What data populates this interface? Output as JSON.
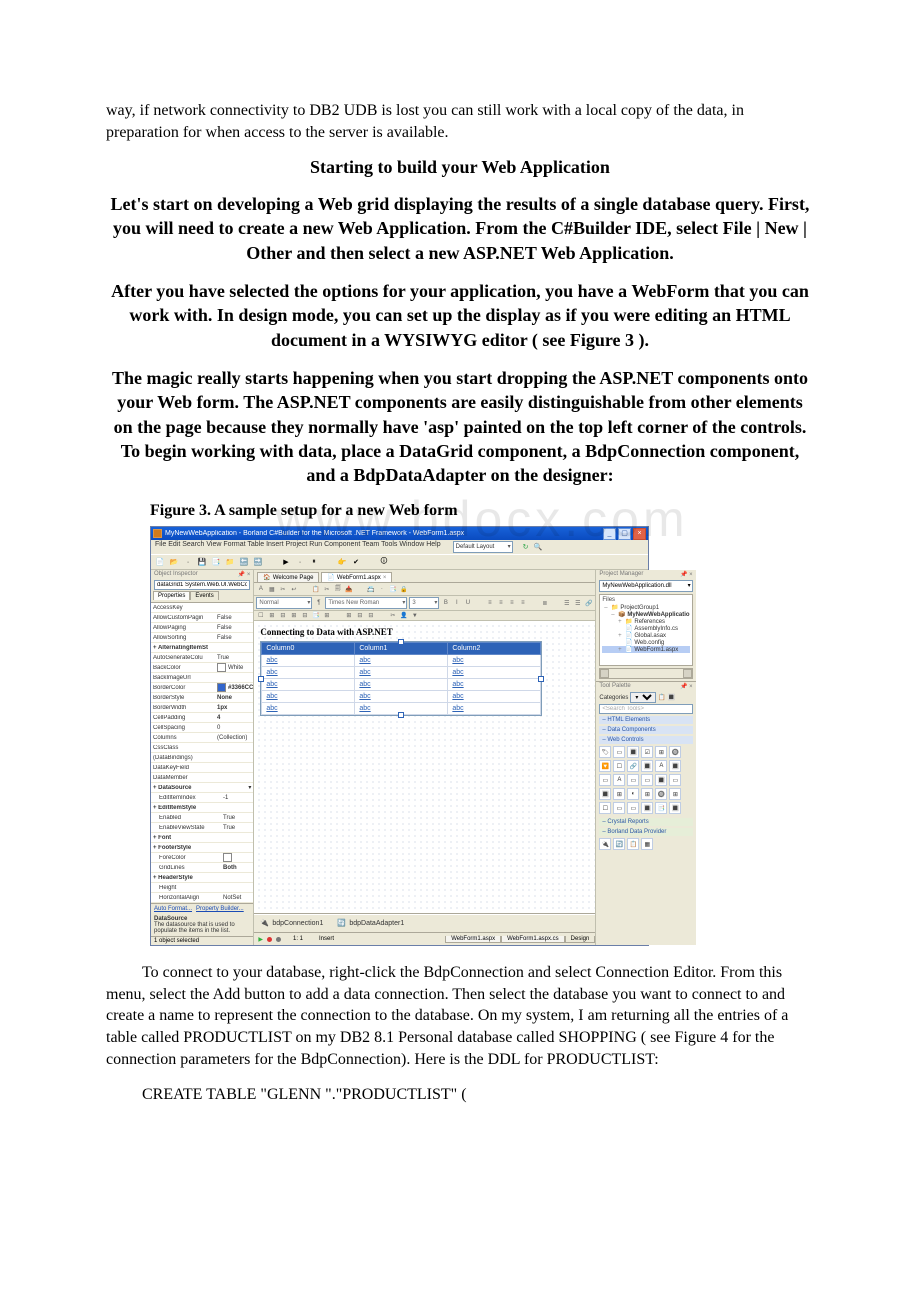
{
  "para_intro": "way, if network connectivity to DB2 UDB is lost you can still work with a local copy of the data, in preparation for when access to the server is available.",
  "heading_start": "Starting to build your Web Application",
  "bold1": "Let's start on developing a Web grid displaying the results of a single database query. First, you will need to create a new Web Application. From the C#Builder IDE, select File | New | Other and then select a new ASP.NET Web Application.",
  "bold2": "After you have selected the options for your application, you have a WebForm that you can work with. In design mode, you can set up the display as if you were editing an HTML document in a WYSIWYG editor ( see Figure 3 ).",
  "bold3": "The magic really starts happening when you start dropping the ASP.NET components onto your Web form. The ASP.NET components are easily distinguishable from other elements on the page because they normally have 'asp' painted on the top left corner of the controls. To begin working with data, place a DataGrid component, a BdpConnection component, and a BdpDataAdapter on the designer:",
  "figure_caption": "Figure 3. A sample setup for a new Web form",
  "watermark": "www.bdocx.com",
  "para_after1": "To connect to your database, right-click the BdpConnection and select Connection Editor. From this menu, select the Add button to add a data connection. Then select the database you want to connect to and create a name to represent the connection to the database. On my system, I am returning all the entries of a table called PRODUCTLIST on my DB2 8.1 Personal database called SHOPPING ( see Figure 4 for the connection parameters for the BdpConnection). Here is the DDL for PRODUCTLIST:",
  "code_line": "CREATE TABLE \"GLENN \".\"PRODUCTLIST\" (",
  "ide": {
    "title": "MyNewWebApplication - Borland C#Builder for the Microsoft .NET Framework - WebForm1.aspx",
    "menu": [
      "File",
      "Edit",
      "Search",
      "View",
      "Format",
      "Table",
      "Insert",
      "Project",
      "Run",
      "Component",
      "Team",
      "Tools",
      "Window",
      "Help"
    ],
    "layout_combo": "Default Layout",
    "toolbar_icons": [
      "📄",
      "📂",
      "·",
      "💾",
      "📑",
      "📁",
      "🔙",
      "🔜",
      " ",
      "▶",
      "·",
      "⏸",
      " ",
      "👉",
      "✔",
      " ",
      "🛈"
    ],
    "left": {
      "header": "Object Inspector",
      "close": "×",
      "combo": "dataGrid1 System.Web.UI.WebCon",
      "tabs": [
        "Properties",
        "Events"
      ],
      "props": [
        {
          "n": "AccessKey",
          "v": ""
        },
        {
          "n": "AllowCustomPagin",
          "v": "False"
        },
        {
          "n": "AllowPaging",
          "v": "False"
        },
        {
          "n": "AllowSorting",
          "v": "False"
        },
        {
          "n": "AlternatingItemSt",
          "v": "",
          "section": true,
          "exp": "+"
        },
        {
          "n": "AutoGenerateColu",
          "v": "True"
        },
        {
          "n": "BackColor",
          "v": "White",
          "swatch": "#ffffff"
        },
        {
          "n": "BackImageUrl",
          "v": ""
        },
        {
          "n": "BorderColor",
          "v": "#3366CC",
          "swatch": "#3366CC",
          "bold": true
        },
        {
          "n": "BorderStyle",
          "v": "None",
          "bold": true
        },
        {
          "n": "BorderWidth",
          "v": "1px",
          "bold": true
        },
        {
          "n": "CellPadding",
          "v": "4",
          "bold": true
        },
        {
          "n": "CellSpacing",
          "v": "0"
        },
        {
          "n": "Columns",
          "v": "(Collection)"
        },
        {
          "n": "CssClass",
          "v": ""
        },
        {
          "n": "(DataBindings)",
          "v": ""
        },
        {
          "n": "DataKeyField",
          "v": ""
        },
        {
          "n": "DataMember",
          "v": ""
        },
        {
          "n": "DataSource",
          "v": "",
          "section": true,
          "exp": "+",
          "dd": true
        },
        {
          "n": "EditItemIndex",
          "v": "-1",
          "indent": true
        },
        {
          "n": "EditItemStyle",
          "v": "",
          "section": true,
          "exp": "+"
        },
        {
          "n": "Enabled",
          "v": "True",
          "indent": true
        },
        {
          "n": "EnableViewState",
          "v": "True",
          "indent": true
        },
        {
          "n": "Font",
          "v": "",
          "section": true,
          "exp": "+"
        },
        {
          "n": "FooterStyle",
          "v": "",
          "section": true,
          "exp": "+"
        },
        {
          "n": "ForeColor",
          "v": "",
          "swatch": "#ffffff",
          "indent": true
        },
        {
          "n": "GridLines",
          "v": "Both",
          "bold": true,
          "indent": true
        },
        {
          "n": "HeaderStyle",
          "v": "",
          "section": true,
          "exp": "+"
        },
        {
          "n": "Height",
          "v": "",
          "indent": true
        },
        {
          "n": "HorizontalAlign",
          "v": "NotSet",
          "indent": true
        }
      ],
      "links": [
        "Auto Format...",
        "Property Builder..."
      ],
      "desc_title": "DataSource",
      "desc_body": "The datasource that is used to populate the items in the list.",
      "status": "1 object selected"
    },
    "center": {
      "tabs": [
        {
          "label": "Welcome Page",
          "icon": "🏠",
          "active": false
        },
        {
          "label": "WebForm1.aspx",
          "icon": "📄",
          "active": true,
          "close": true
        }
      ],
      "fmt_icons_a": [
        "A",
        "▦",
        "✂",
        "↩",
        " ",
        "📋",
        "✂",
        "🗐",
        "📥",
        " ",
        "📇",
        "·",
        "📑",
        "🔒"
      ],
      "style_dd": "Normal",
      "paragraph_icon": "¶",
      "font_dd": "Times New Roman",
      "size_dd": "3",
      "fmt_icons_b": [
        "B",
        "I",
        "U",
        " ",
        "≡",
        "≡",
        "≡",
        "≡",
        " ",
        "≣",
        " ",
        "☰",
        "☰",
        "🔗"
      ],
      "ruler_icons": [
        "☐",
        "⊞",
        "⊟",
        "⊞",
        "⊟",
        "📑",
        "⊞",
        " ",
        "⊞",
        "⊟",
        "⊟",
        " ",
        "✂",
        "👤",
        "▼"
      ],
      "doc_heading": "Connecting to Data with ASP.NET",
      "grid": {
        "cols": [
          "Column0",
          "Column1",
          "Column2"
        ],
        "cells": [
          [
            "abc",
            "abc",
            "abc"
          ],
          [
            "abc",
            "abc",
            "abc"
          ],
          [
            "abc",
            "abc",
            "abc"
          ],
          [
            "abc",
            "abc",
            "abc"
          ],
          [
            "abc",
            "abc",
            "abc"
          ]
        ]
      },
      "components": [
        {
          "icon": "🔌",
          "label": "bdpConnection1",
          "color": "#d24aa0"
        },
        {
          "icon": "🔄",
          "label": "bdpDataAdapter1",
          "color": "#3a8f3a"
        }
      ],
      "status": {
        "dots": [
          "#2fb23b",
          "#d33",
          "#777"
        ],
        "pos": "1: 1",
        "mode": "Insert",
        "bottom_tabs": [
          "WebForm1.aspx",
          "WebForm1.aspx.cs",
          "Design"
        ]
      }
    },
    "right": {
      "pm_header": "Project Manager",
      "pm_combo": "MyNewWebApplication.dll",
      "files_header": "Files",
      "tree": [
        {
          "icon": "📁",
          "exp": "–",
          "label": "ProjectGroup1",
          "color": "#c88b2b"
        },
        {
          "icon": "📦",
          "exp": "–",
          "label": "MyNewWebApplicatio",
          "indent": 1,
          "color": "#c88b2b",
          "bold": true
        },
        {
          "icon": "📁",
          "exp": "+",
          "label": "References",
          "indent": 2,
          "color": "#7aa6d8"
        },
        {
          "icon": "📄",
          "exp": " ",
          "label": "AssemblyInfo.cs",
          "indent": 2,
          "color": "#9fbf6a"
        },
        {
          "icon": "📄",
          "exp": "+",
          "label": "Global.asax",
          "indent": 2,
          "color": "#7aa6d8"
        },
        {
          "icon": "📄",
          "exp": " ",
          "label": "Web.config",
          "indent": 2,
          "color": "#7aa6d8"
        },
        {
          "icon": "📄",
          "exp": "+",
          "label": "WebForm1.aspx",
          "indent": 2,
          "sel": true,
          "color": "#7aa6d8"
        }
      ],
      "tp_header": "Tool Palette",
      "categories_label": "Categories",
      "search_placeholder": "<Search Tools>",
      "groups": [
        {
          "name": "HTML Elements",
          "color": "#d8e3f4"
        },
        {
          "name": "Data Components",
          "color": "#d8e3f4"
        },
        {
          "name": "Web Controls",
          "color": "#d8e3f4",
          "icons": [
            "🏷",
            "▭",
            "🔳",
            "☑",
            "⊞",
            "🔘",
            "🔽",
            "☐",
            "🔗",
            "🔳",
            "A",
            "🔳",
            "▭",
            "A",
            "▭",
            "▭",
            "🔳",
            "▭",
            "🔳",
            "⊞",
            "◐",
            "⊞",
            "🔘",
            "⊞",
            "☐",
            "▭",
            "▭",
            "🔳",
            "📑",
            "🔳"
          ]
        },
        {
          "name": "Crystal Reports",
          "color": "#e6eed8"
        },
        {
          "name": "Borland Data Provider",
          "color": "#e6eed8",
          "icons": [
            "🔌",
            "🔄",
            "📋",
            "▦"
          ]
        }
      ]
    }
  }
}
